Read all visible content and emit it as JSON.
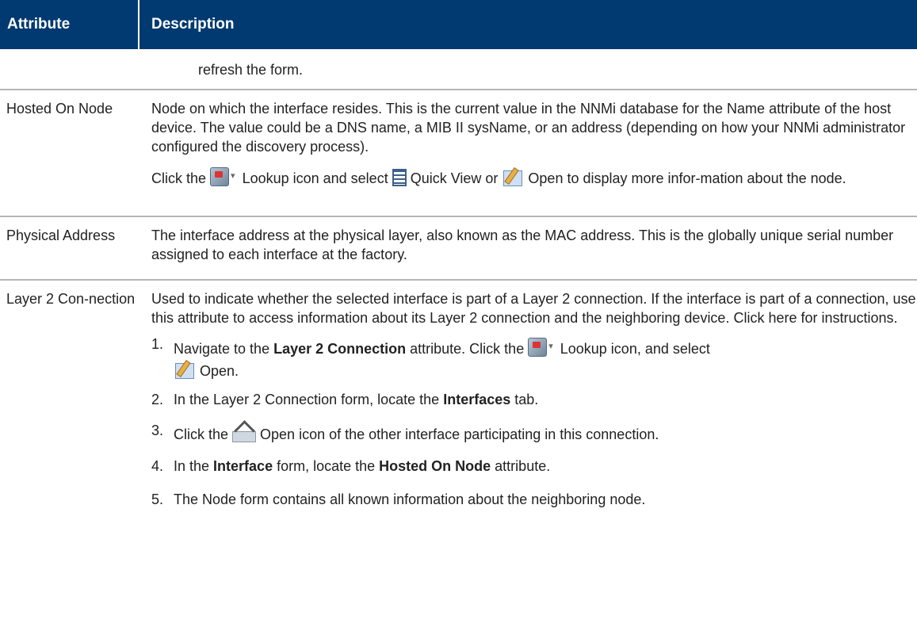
{
  "header": {
    "attribute": "Attribute",
    "description": "Description"
  },
  "rows": {
    "refresh": {
      "desc": "refresh the form."
    },
    "hosted": {
      "attr": "Hosted On Node",
      "p1": "Node on which the interface resides. This is the current value in the NNMi database for the Name attribute of the host device. The value could be a DNS name, a MIB II sysName, or an address (depending on how your NNMi administrator configured the discovery process).",
      "p2_a": "Click the ",
      "p2_b": " Lookup icon and select ",
      "p2_c": " Quick View or ",
      "p2_d": " Open to display more infor-mation about the node."
    },
    "physical": {
      "attr": "Physical Address",
      "desc": "The interface address at the physical layer, also known as the MAC address. This is the globally unique serial number assigned to each interface at the factory."
    },
    "layer2": {
      "attr": "Layer 2 Con-nection",
      "desc": "Used to indicate whether the selected interface is part of a Layer 2 connection. If the interface is part of a connection, use this attribute to access information about its Layer 2 connection and the neighboring device. Click here for instructions.",
      "steps": {
        "s1": {
          "num": "1.",
          "a": "Navigate to the ",
          "b": "Layer 2 Connection",
          "c": " attribute. Click the ",
          "d": " Lookup icon, and select ",
          "e": " Open."
        },
        "s2": {
          "num": "2.",
          "a": "In the Layer 2 Connection form, locate the ",
          "b": "Interfaces",
          "c": " tab."
        },
        "s3": {
          "num": "3.",
          "a": "Click the ",
          "b": " Open icon of the other interface participating in this connection."
        },
        "s4": {
          "num": "4.",
          "a": "In the ",
          "b": "Interface",
          "c": " form, locate the ",
          "d": "Hosted On Node",
          "e": " attribute."
        },
        "s5": {
          "num": "5.",
          "a": "The Node form contains all known information about the neighboring node."
        }
      }
    }
  },
  "icons": [
    "lookup-icon",
    "dropdown-arrow-icon",
    "quick-view-icon",
    "open-icon",
    "open-form-icon"
  ]
}
